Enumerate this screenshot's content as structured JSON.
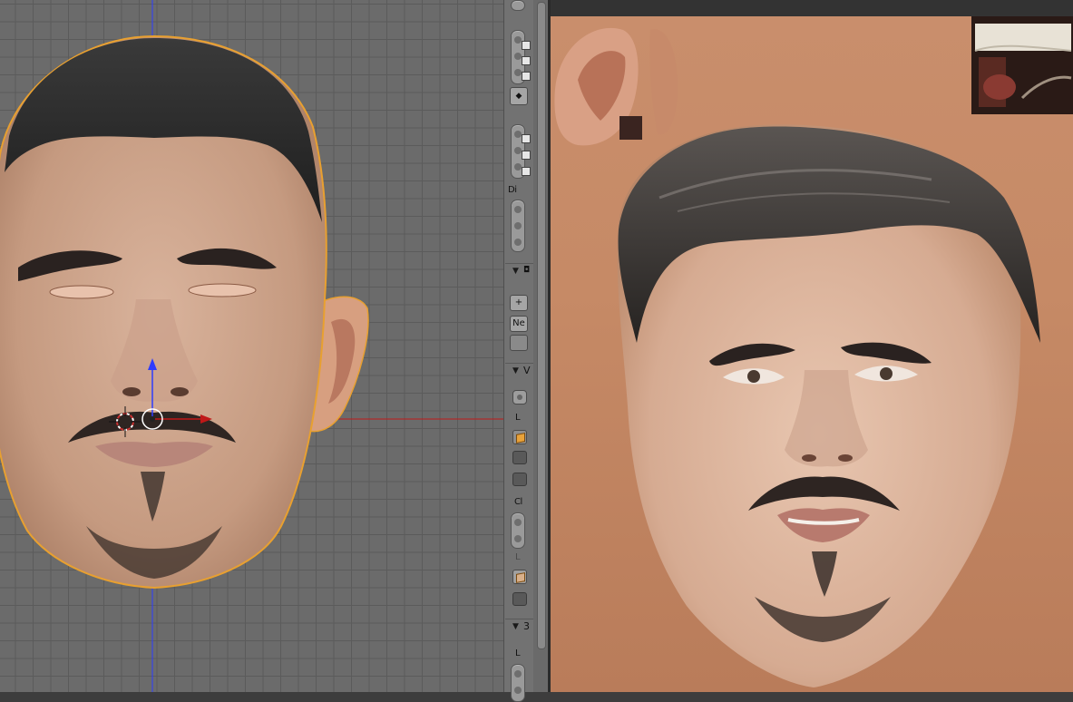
{
  "toolstrip": {
    "label_di": "Di",
    "label_l1": "L",
    "label_cl": "Cl",
    "label_l2": "L",
    "label_l3": "L",
    "panel_v": "V",
    "panel_3": "3",
    "button_ne": "Ne",
    "plus_icon": "+"
  },
  "colors": {
    "viewport_bg": "#6b6b6b",
    "grid_line": "#5b5b5b",
    "axis_blue": "#2d3cff",
    "axis_red": "#c01818",
    "selection_outline": "#e8a030",
    "uv_background": "#c98e6c"
  },
  "icons": [
    "3d-cursor-icon",
    "transform-gizmo-icon",
    "cube-icon",
    "plus-icon",
    "checkbox-icon"
  ]
}
